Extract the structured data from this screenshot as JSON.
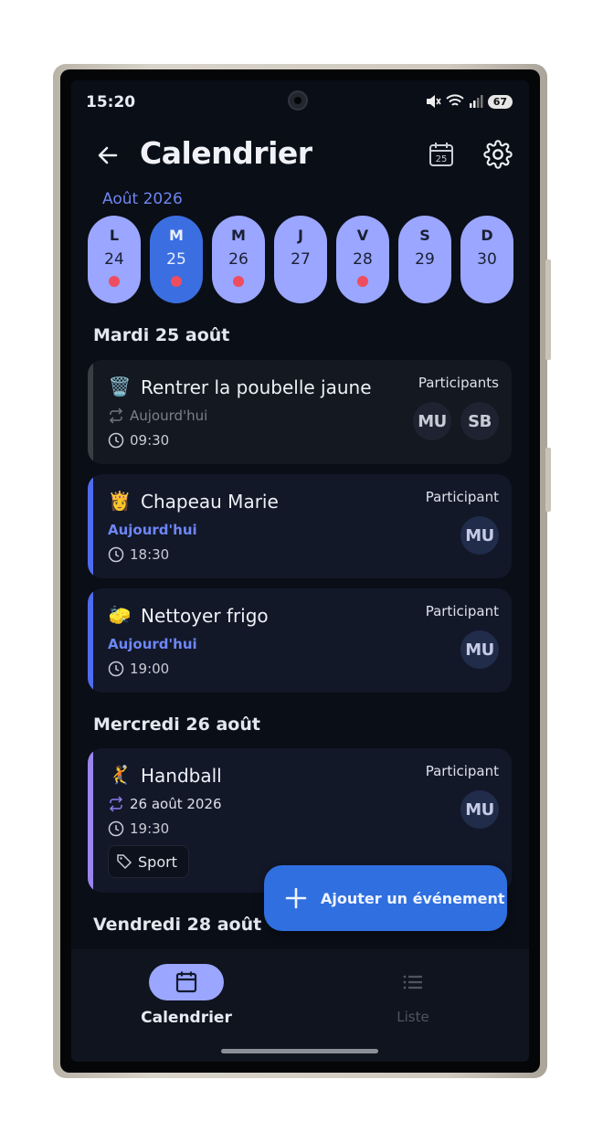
{
  "status": {
    "time": "15:20",
    "battery": "67"
  },
  "header": {
    "title": "Calendrier",
    "calendar_day": "25"
  },
  "month_label": "Août 2026",
  "days": [
    {
      "letter": "L",
      "num": "24",
      "dot": true,
      "selected": false
    },
    {
      "letter": "M",
      "num": "25",
      "dot": true,
      "selected": true
    },
    {
      "letter": "M",
      "num": "26",
      "dot": true,
      "selected": false
    },
    {
      "letter": "J",
      "num": "27",
      "dot": false,
      "selected": false
    },
    {
      "letter": "V",
      "num": "28",
      "dot": true,
      "selected": false
    },
    {
      "letter": "S",
      "num": "29",
      "dot": false,
      "selected": false
    },
    {
      "letter": "D",
      "num": "30",
      "dot": false,
      "selected": false
    }
  ],
  "sections": {
    "tue": "Mardi 25 août",
    "wed": "Mercredi 26 août",
    "fri": "Vendredi 28 août"
  },
  "events": [
    {
      "emoji": "🗑️",
      "title": "Rentrer la poubelle jaune",
      "recurrence": "Aujourd'hui",
      "time": "09:30",
      "participants_label": "Participants",
      "participants": [
        "MU",
        "SB"
      ]
    },
    {
      "emoji": "👸",
      "title": "Chapeau Marie",
      "date": "Aujourd'hui",
      "time": "18:30",
      "participants_label": "Participant",
      "participants": [
        "MU"
      ]
    },
    {
      "emoji": "🧽",
      "title": "Nettoyer frigo",
      "date": "Aujourd'hui",
      "time": "19:00",
      "participants_label": "Participant",
      "participants": [
        "MU"
      ]
    },
    {
      "emoji": "🤾",
      "title": "Handball",
      "recurrence": "26 août 2026",
      "time": "19:30",
      "tag": "Sport",
      "participants_label": "Participant",
      "participants": [
        "MU"
      ]
    }
  ],
  "fab": {
    "label": "Ajouter un événement"
  },
  "bottom_nav": {
    "calendar": "Calendrier",
    "list": "Liste"
  },
  "colors": {
    "accent": "#3b6ee0",
    "day_pill": "#9aa6ff",
    "today_text": "#6e86f5",
    "event_dot": "#ee4d5f"
  }
}
